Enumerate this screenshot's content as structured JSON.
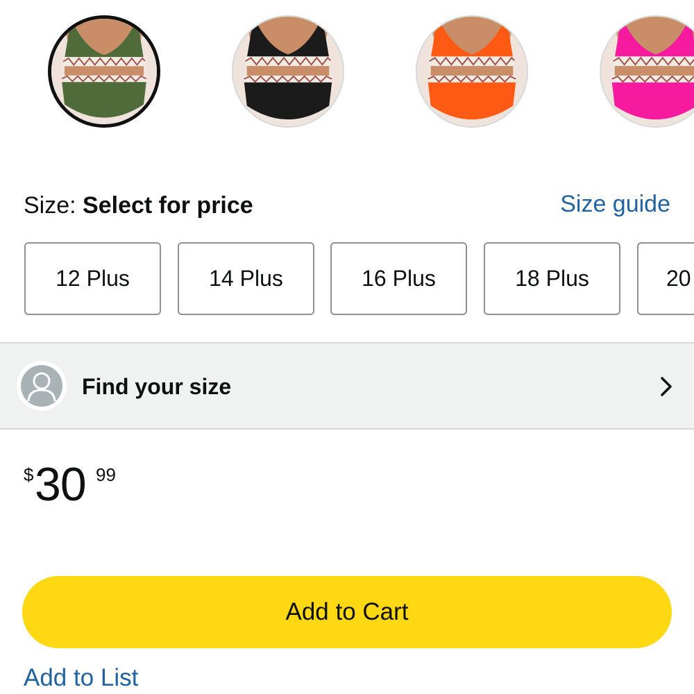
{
  "colors": {
    "swatches": [
      {
        "name": "Army Green",
        "body": "#4f6b3a",
        "selected": true
      },
      {
        "name": "Black",
        "body": "#1b1b1b",
        "selected": false
      },
      {
        "name": "Orange",
        "body": "#ff5a14",
        "selected": false
      },
      {
        "name": "Hot Pink",
        "body": "#f51a9e",
        "selected": false
      }
    ],
    "skin": "#c98d67",
    "trim": "#f2ebe3",
    "accent_link": "#2162a1",
    "cart_button": "#ffd814"
  },
  "size": {
    "prefix": "Size: ",
    "value": "Select for price",
    "guide_label": "Size guide",
    "options": [
      "12 Plus",
      "14 Plus",
      "16 Plus",
      "18 Plus",
      "20"
    ]
  },
  "find_size": {
    "label": "Find your size",
    "icon": "user-icon",
    "chevron_icon": "chevron-right-icon"
  },
  "price": {
    "symbol": "$",
    "whole": "30",
    "fraction": "99"
  },
  "actions": {
    "add_to_cart": "Add to Cart",
    "add_to_list": "Add to List"
  }
}
